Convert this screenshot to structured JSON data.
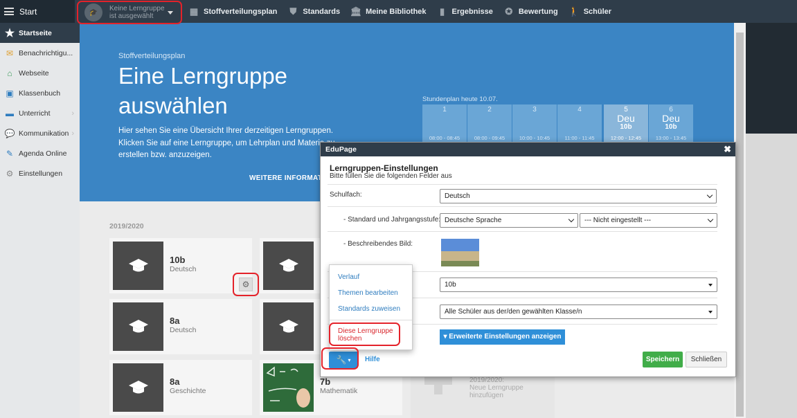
{
  "topbar": {
    "start_label": "Start",
    "group_selector": "Keine Lerngruppe ist ausgewählt",
    "nav": [
      {
        "label": "Stoffverteilungsplan",
        "icon": "table-icon"
      },
      {
        "label": "Standards",
        "icon": "shield-icon"
      },
      {
        "label": "Meine Bibliothek",
        "icon": "library-icon"
      },
      {
        "label": "Ergebnisse",
        "icon": "bar-chart-icon"
      },
      {
        "label": "Bewertung",
        "icon": "badge-icon"
      },
      {
        "label": "Schüler",
        "icon": "students-icon"
      }
    ]
  },
  "sidebar": {
    "items": [
      {
        "label": "Startseite",
        "icon": "star-icon"
      },
      {
        "label": "Benachrichtigu...",
        "icon": "envelope-icon"
      },
      {
        "label": "Webseite",
        "icon": "home-icon"
      },
      {
        "label": "Klassenbuch",
        "icon": "book-icon"
      },
      {
        "label": "Unterricht",
        "icon": "briefcase-icon"
      },
      {
        "label": "Kommunikation",
        "icon": "chat-icon"
      },
      {
        "label": "Agenda Online",
        "icon": "pen-icon"
      },
      {
        "label": "Einstellungen",
        "icon": "gear-icon"
      }
    ]
  },
  "hero": {
    "subtitle": "Stoffverteilungsplan",
    "title": "Eine Lerngruppe auswählen",
    "text": "Hier sehen Sie eine Übersicht Ihrer derzeitigen Lerngruppen. Klicken Sie auf eine Lerngruppe, um Lehrplan und Materia zu erstellen bzw. anzuzeigen.",
    "more": "WEITERE INFORMATIO"
  },
  "schedule": {
    "title": "Stundenplan heute 10.07.",
    "slots": [
      {
        "num": "1",
        "time": "08:00 - 08:45"
      },
      {
        "num": "2",
        "time": "08:00 - 09:45"
      },
      {
        "num": "3",
        "time": "10:00 - 10:45"
      },
      {
        "num": "4",
        "time": "11:00 - 11:45"
      },
      {
        "num": "5",
        "subject": "Deu",
        "class": "10b",
        "time": "12:00 - 12:45"
      },
      {
        "num": "6",
        "subject": "Deu",
        "class": "10b",
        "time": "13:00 - 13:45"
      }
    ]
  },
  "groups": {
    "year": "2019/2020",
    "cards": [
      {
        "title": "10b",
        "subject": "Deutsch"
      },
      {
        "title": "8a",
        "subject": "Deutsch"
      },
      {
        "title": "8a",
        "subject": "Geschichte"
      },
      {
        "title": "7b",
        "subject": "Mathematik"
      }
    ],
    "new_card": {
      "year": "2019/2020:",
      "text": "Neue Lerngruppe hinzufügen"
    }
  },
  "modal": {
    "header": "EduPage",
    "title": "Lerngruppen-Einstellungen",
    "hint": "Bitte füllen Sie die folgenden Felder aus",
    "fields": {
      "subject_label": "Schulfach:",
      "subject_value": "Deutsch",
      "standard_label": "- Standard und Jahrgangsstufe:",
      "standard_value": "Deutsche Sprache",
      "grade_value": "--- Nicht eingestellt ---",
      "image_label": "- Beschreibendes Bild:",
      "class_value": "10b",
      "students_value": "Alle Schüler aus der/den gewählten Klasse/n"
    },
    "advanced_button": "Erweiterte Einstellungen anzeigen",
    "help": "Hilfe",
    "save": "Speichern",
    "close": "Schließen"
  },
  "dropdown": {
    "items": [
      "Verlauf",
      "Themen bearbeiten",
      "Standards zuweisen"
    ],
    "danger": "Diese Lerngruppe löschen"
  },
  "colors": {
    "hero_blue": "#3b85c4",
    "topbar": "#2f3d4a",
    "accent_blue": "#2f8fd8",
    "save_green": "#41ad49",
    "highlight_red": "#e4222a"
  }
}
